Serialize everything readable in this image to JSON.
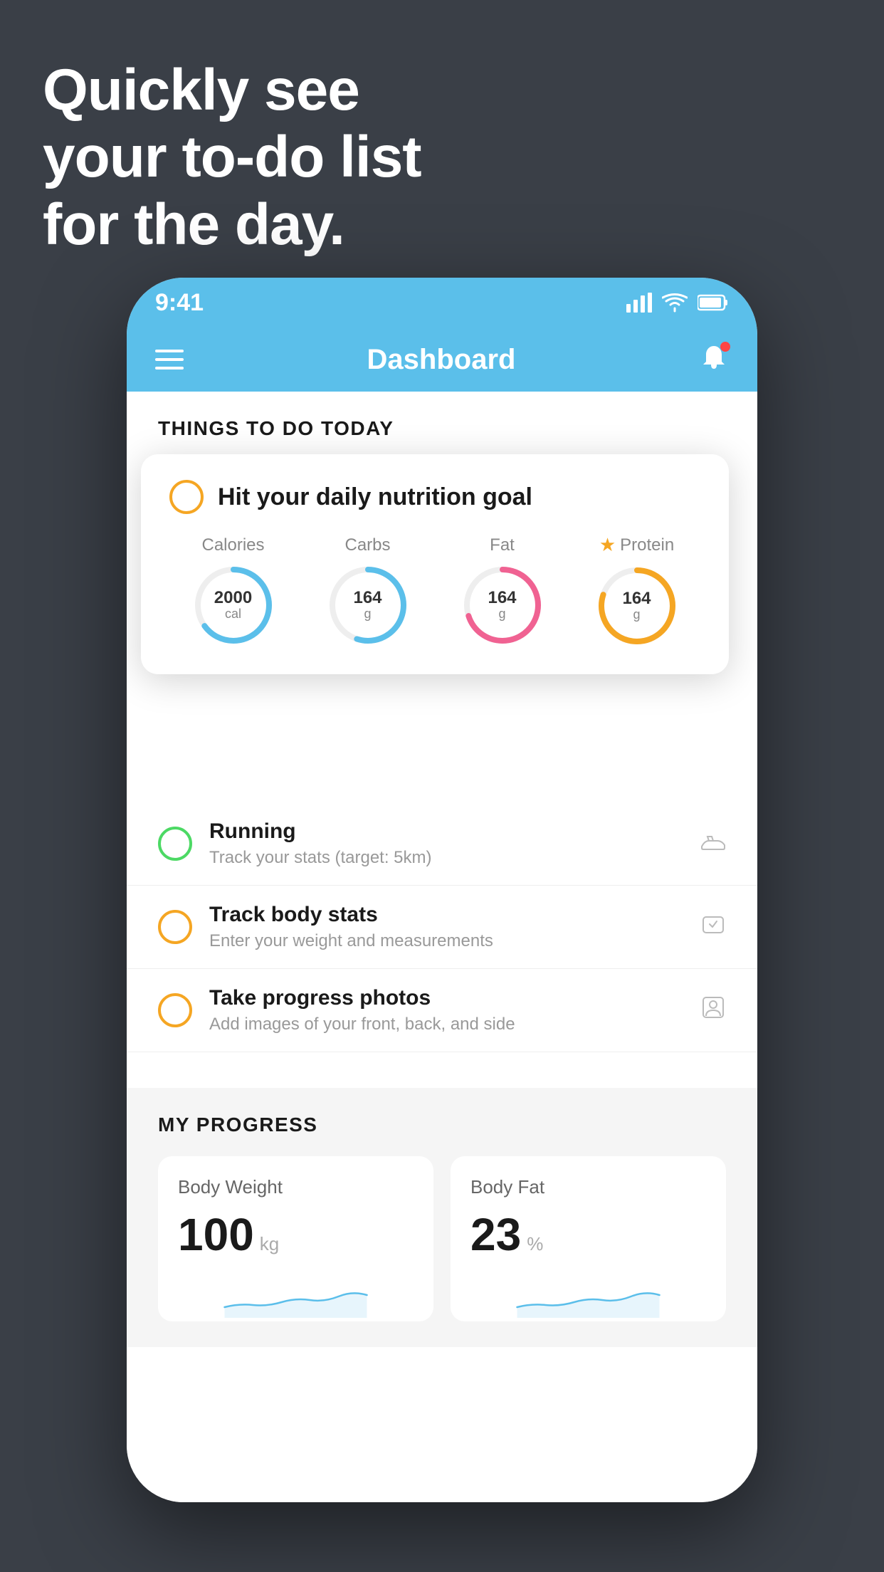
{
  "headline": {
    "line1": "Quickly see",
    "line2": "your to-do list",
    "line3": "for the day."
  },
  "phone": {
    "statusBar": {
      "time": "9:41",
      "signal": "▂▄▆█",
      "wifi": "wifi",
      "battery": "battery"
    },
    "navbar": {
      "title": "Dashboard"
    },
    "todaySection": {
      "header": "THINGS TO DO TODAY"
    },
    "floatingCard": {
      "title": "Hit your daily nutrition goal",
      "nutrients": [
        {
          "label": "Calories",
          "value": "2000",
          "unit": "cal",
          "color": "#5bbfea",
          "percent": 65
        },
        {
          "label": "Carbs",
          "value": "164",
          "unit": "g",
          "color": "#5bbfea",
          "percent": 55
        },
        {
          "label": "Fat",
          "value": "164",
          "unit": "g",
          "color": "#f06292",
          "percent": 70
        },
        {
          "label": "Protein",
          "value": "164",
          "unit": "g",
          "color": "#f5a623",
          "percent": 80,
          "star": true
        }
      ]
    },
    "todoItems": [
      {
        "title": "Running",
        "subtitle": "Track your stats (target: 5km)",
        "circleType": "green",
        "icon": "shoe"
      },
      {
        "title": "Track body stats",
        "subtitle": "Enter your weight and measurements",
        "circleType": "yellow",
        "icon": "scale"
      },
      {
        "title": "Take progress photos",
        "subtitle": "Add images of your front, back, and side",
        "circleType": "yellow",
        "icon": "person"
      }
    ],
    "progressSection": {
      "header": "MY PROGRESS",
      "cards": [
        {
          "title": "Body Weight",
          "value": "100",
          "unit": "kg"
        },
        {
          "title": "Body Fat",
          "value": "23",
          "unit": "%"
        }
      ]
    }
  }
}
